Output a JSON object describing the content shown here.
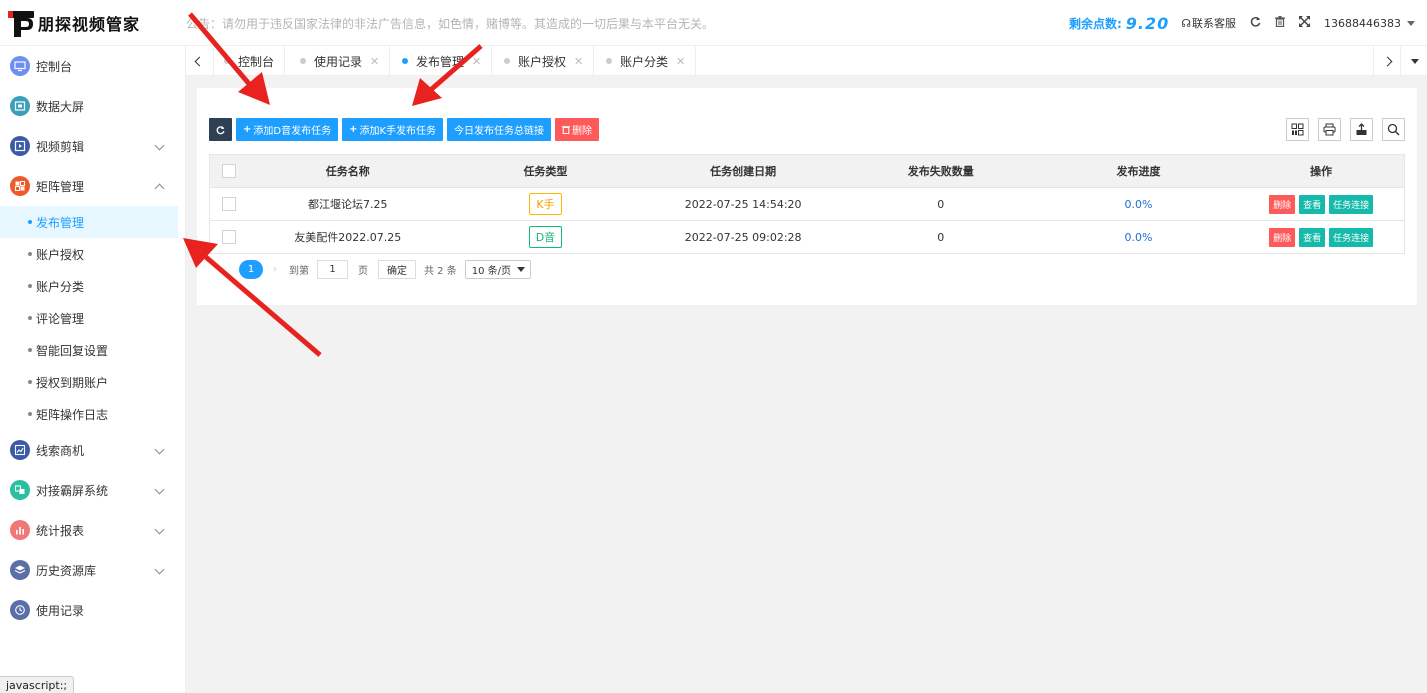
{
  "header": {
    "logo_text": "朋探视频管家",
    "notice": "公告：请勿用于违反国家法律的非法广告信息，如色情，赌博等。其造成的一切后果与本平台无关。",
    "points_label": "剩余点数:",
    "points_value": "9.20",
    "contact_label": "联系客服",
    "user": "13688446383"
  },
  "sidebar": {
    "items": [
      {
        "label": "控制台",
        "icon": "monitor-icon",
        "color": "#6b8ff5"
      },
      {
        "label": "数据大屏",
        "icon": "screen-icon",
        "color": "#3aa0b8"
      },
      {
        "label": "视频剪辑",
        "icon": "video-edit-icon",
        "color": "#3b5ba8"
      },
      {
        "label": "矩阵管理",
        "icon": "matrix-icon",
        "color": "#f05a28"
      },
      {
        "label": "线索商机",
        "icon": "chart-icon",
        "color": "#3b5ba8"
      },
      {
        "label": "对接霸屏系统",
        "icon": "connect-icon",
        "color": "#28c0a0"
      },
      {
        "label": "统计报表",
        "icon": "stats-icon",
        "color": "#f07878"
      },
      {
        "label": "历史资源库",
        "icon": "library-icon",
        "color": "#5a6ea8"
      },
      {
        "label": "使用记录",
        "icon": "clock-icon",
        "color": "#5a6ea8"
      }
    ],
    "sub_items": [
      "发布管理",
      "账户授权",
      "账户分类",
      "评论管理",
      "智能回复设置",
      "授权到期账户",
      "矩阵操作日志"
    ]
  },
  "tabs": [
    {
      "label": "控制台"
    },
    {
      "label": "使用记录"
    },
    {
      "label": "发布管理"
    },
    {
      "label": "账户授权"
    },
    {
      "label": "账户分类"
    }
  ],
  "toolbar": {
    "add_d": "添加D音发布任务",
    "add_k": "添加K手发布任务",
    "today_links": "今日发布任务总链接",
    "delete": "删除"
  },
  "table": {
    "headers": [
      "任务名称",
      "任务类型",
      "任务创建日期",
      "发布失败数量",
      "发布进度",
      "操作"
    ],
    "rows": [
      {
        "name": "都江堰论坛7.25",
        "type": "K手",
        "date": "2022-07-25 14:54:20",
        "fail": "0",
        "progress": "0.0%"
      },
      {
        "name": "友美配件2022.07.25",
        "type": "D音",
        "date": "2022-07-25 09:02:28",
        "fail": "0",
        "progress": "0.0%"
      }
    ],
    "ops": {
      "delete": "删除",
      "view": "查看",
      "link": "任务连接"
    }
  },
  "pager": {
    "current": "1",
    "goto_label": "到第",
    "page_value": "1",
    "page_unit": "页",
    "confirm": "确定",
    "total": "共 2 条",
    "page_size": "10 条/页"
  },
  "statusbar": "javascript:;",
  "colors": {
    "accent": "#1e9fff",
    "danger": "#ff5a5a",
    "teal": "#16baaa",
    "dark": "#2f4056",
    "arrow": "#e8231f"
  }
}
